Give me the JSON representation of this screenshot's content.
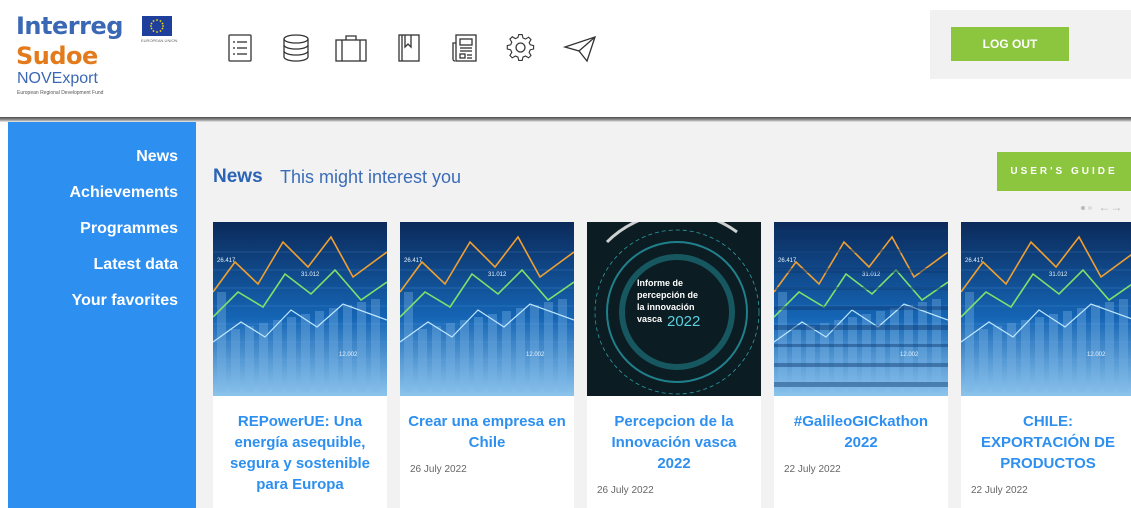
{
  "brand": {
    "line1": "Interreg",
    "line2": "Sudoe",
    "line3": "NOVExport",
    "line4": "European Regional Development Fund",
    "flag_caption": "EUROPEAN UNION"
  },
  "toolbar": {
    "icons": [
      "list-icon",
      "database-icon",
      "briefcase-icon",
      "bookmark-book-icon",
      "newspaper-icon",
      "settings-gear-icon",
      "paper-plane-icon"
    ]
  },
  "header": {
    "logout_label": "LOG OUT"
  },
  "sidebar": {
    "items": [
      {
        "label": "News"
      },
      {
        "label": "Achievements"
      },
      {
        "label": "Programmes"
      },
      {
        "label": "Latest data"
      },
      {
        "label": "Your favorites"
      }
    ]
  },
  "main": {
    "title": "News",
    "subtitle": "This might interest you",
    "guide_label": "USER'S GUIDE",
    "nav_prev": "←",
    "nav_next": "→"
  },
  "cards": [
    {
      "title": "REPowerUE: Una energía asequible, segura y sostenible para Europa",
      "date": "",
      "image": "finance-chart"
    },
    {
      "title": "Crear una empresa en Chile",
      "date": "26 July 2022",
      "image": "finance-chart"
    },
    {
      "title": "Percepcion de la Innovación vasca 2022",
      "date": "26 July 2022",
      "image": "innovation-report",
      "image_text": [
        "Informe de",
        "percepción de",
        "la innovación",
        "vasca"
      ],
      "image_year": "2022"
    },
    {
      "title": "#GalileoGICkathon 2022",
      "date": "22 July 2022",
      "image": "finance-chart-glitch"
    },
    {
      "title": "CHILE: EXPORTACIÓN DE PRODUCTOS",
      "date": "22 July 2022",
      "image": "finance-chart"
    }
  ],
  "chart_labels": {
    "a": "26.417",
    "b": "31.012",
    "c": "12.002"
  },
  "colors": {
    "accent_green": "#8cc63f",
    "sidebar_blue": "#2d8ff0",
    "title_blue": "#2b63b5"
  }
}
